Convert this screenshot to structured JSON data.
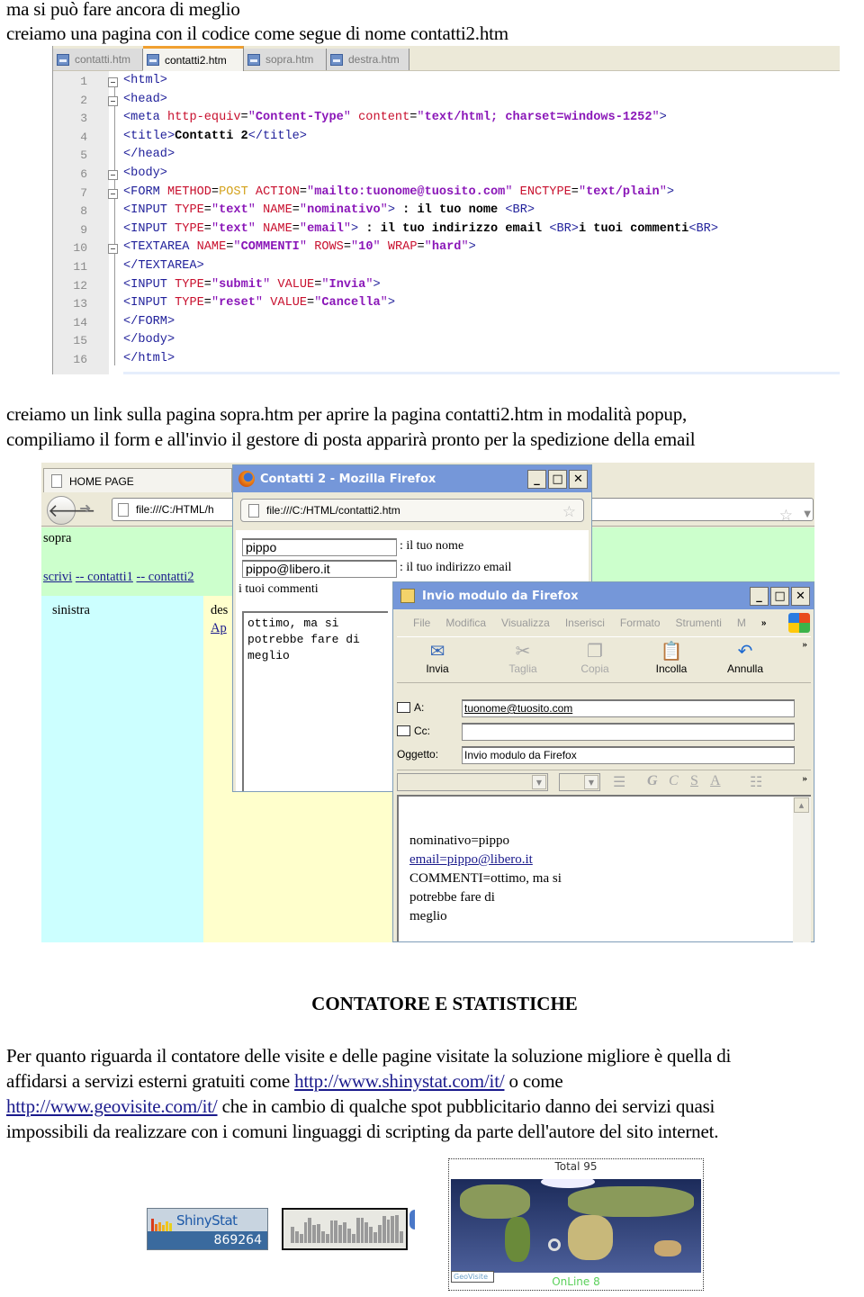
{
  "intro": {
    "line1": "ma si  può fare ancora di meglio",
    "line2": "creiamo una pagina con il codice come segue di nome contatti2.htm"
  },
  "editor": {
    "tabs": [
      {
        "label": "contatti.htm",
        "active": false
      },
      {
        "label": "contatti2.htm",
        "active": true
      },
      {
        "label": "sopra.htm",
        "active": false
      },
      {
        "label": "destra.htm",
        "active": false
      }
    ],
    "lines": [
      "<html>",
      "<head>",
      "<meta http-equiv=\"Content-Type\" content=\"text/html; charset=windows-1252\">",
      "<title>Contatti 2</title>",
      "</head>",
      "<body>",
      "<FORM METHOD=POST ACTION=\"mailto:tuonome@tuosito.com\" ENCTYPE=\"text/plain\">",
      "<INPUT TYPE=\"text\" NAME=\"nominativo\"> : il tuo nome <BR>",
      "<INPUT TYPE=\"text\" NAME=\"email\"> : il tuo indirizzo email <BR>i tuoi commenti<BR>",
      "<TEXTAREA NAME=\"COMMENTI\" ROWS=\"10\" WRAP=\"hard\">",
      "</TEXTAREA>",
      "<INPUT TYPE=\"submit\" VALUE=\"Invia\">",
      "<INPUT TYPE=\"reset\" VALUE=\"Cancella\">",
      "</FORM>",
      "</body>",
      "</html>"
    ]
  },
  "middle": {
    "line1": "creiamo un link sulla pagina sopra.htm per aprire la pagina contatti2.htm in modalità popup,",
    "line2": "compiliamo il form e all'invio il gestore di posta apparirà pronto per la spedizione della email"
  },
  "browser": {
    "tab_title": "HOME PAGE",
    "url": "file:///C:/HTML/h",
    "frame_top_text": "sopra",
    "frame_links": [
      "scrivi",
      "-- contatti1",
      "-- contatti2"
    ],
    "frame_left_text": "sinistra",
    "frame_right_text": "des",
    "frame_right_link": "Ap"
  },
  "popup": {
    "title": "Contatti 2 - Mozilla Firefox",
    "url": "file:///C:/HTML/contatti2.htm",
    "name_value": "pippo",
    "name_label": ": il tuo nome",
    "email_value": "pippo@libero.it",
    "email_label": ": il tuo indirizzo email",
    "comments_label": "i tuoi commenti",
    "comments_value": "ottimo, ma si\npotrebbe fare di\nmeglio"
  },
  "mail": {
    "title": "Invio modulo da Firefox",
    "menu": [
      "File",
      "Modifica",
      "Visualizza",
      "Inserisci",
      "Formato",
      "Strumenti",
      "M"
    ],
    "tools": [
      {
        "label": "Invia",
        "icon": "send-icon",
        "enabled": true
      },
      {
        "label": "Taglia",
        "icon": "scissors-icon",
        "enabled": false
      },
      {
        "label": "Copia",
        "icon": "copy-icon",
        "enabled": false
      },
      {
        "label": "Incolla",
        "icon": "paste-icon",
        "enabled": true
      },
      {
        "label": "Annulla",
        "icon": "undo-icon",
        "enabled": true
      }
    ],
    "to_label": "A:",
    "to_value": "tuonome@tuosito.com",
    "cc_label": "Cc:",
    "cc_value": "",
    "subject_label": "Oggetto:",
    "subject_value": "Invio modulo da Firefox",
    "format_buttons": [
      "G",
      "C",
      "S",
      "A"
    ],
    "body_lines": [
      {
        "text": "nominativo=pippo",
        "link": false
      },
      {
        "text": "email=pippo@libero.it",
        "link": true
      },
      {
        "text": "COMMENTI=ottimo, ma si",
        "link": false
      },
      {
        "text": "potrebbe fare di",
        "link": false
      },
      {
        "text": "meglio",
        "link": false
      }
    ]
  },
  "section": {
    "heading": "CONTATORE E STATISTICHE",
    "p_line1": "Per quanto riguarda il contatore delle visite e delle pagine visitate la soluzione migliore è quella di",
    "p_line2_pre": "affidarsi a servizi esterni gratuiti come ",
    "link1": "http://www.shinystat.com/it/",
    "p_line2_post": " o come",
    "link2": "http://www.geovisite.com/it/",
    "p_line3_post": " che in cambio di qualche spot pubblicitario danno dei servizi quasi",
    "p_line4": "impossibili da realizzare con i comuni linguaggi di scripting da parte dell'autore del sito internet."
  },
  "widgets": {
    "shinystat_label": "ShinyStat",
    "shinystat_count": "869264",
    "geovisite_total": "Total 95",
    "geovisite_online": "OnLine 8",
    "geovisite_logo": "GeoVisite"
  },
  "colors": {
    "frame_top": "#ccffcc",
    "frame_left": "#ccffff",
    "frame_right": "#ffffcc",
    "titlebar": "#7597d9",
    "link": "#1a1a8c"
  }
}
